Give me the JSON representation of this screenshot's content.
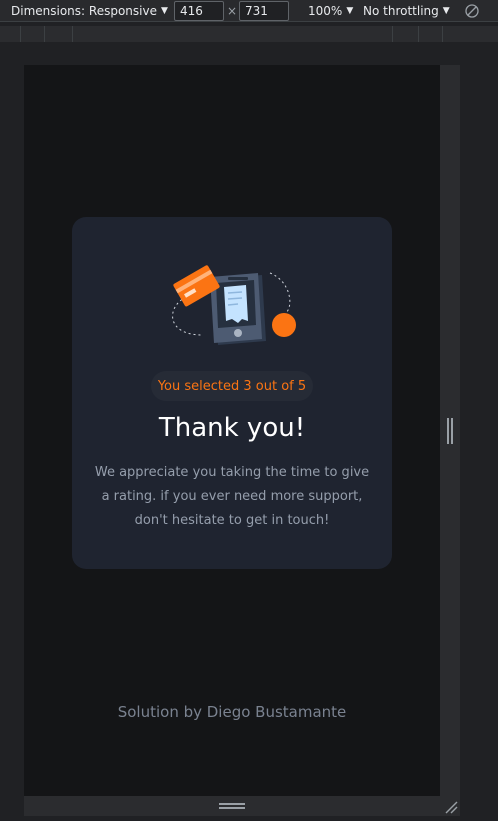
{
  "toolbar": {
    "dimensions_label": "Dimensions: Responsive",
    "width_value": "416",
    "times_symbol": "×",
    "height_value": "731",
    "zoom_label": "100%",
    "throttling_label": "No throttling",
    "rotate_icon": "rotate-icon"
  },
  "card": {
    "illustration_icon": "payment-phone-illustration",
    "selection_text": "You selected 3 out of 5",
    "heading": "Thank you!",
    "description": "We appreciate you taking the time to give a rating. if you ever need more support, don't hesitate to get in touch!"
  },
  "footer": {
    "credit": "Solution by Diego Bustamante"
  },
  "colors": {
    "accent": "#fb7413",
    "card_bg": "#1f2430",
    "page_bg": "#141517",
    "text_muted": "#959eac"
  }
}
